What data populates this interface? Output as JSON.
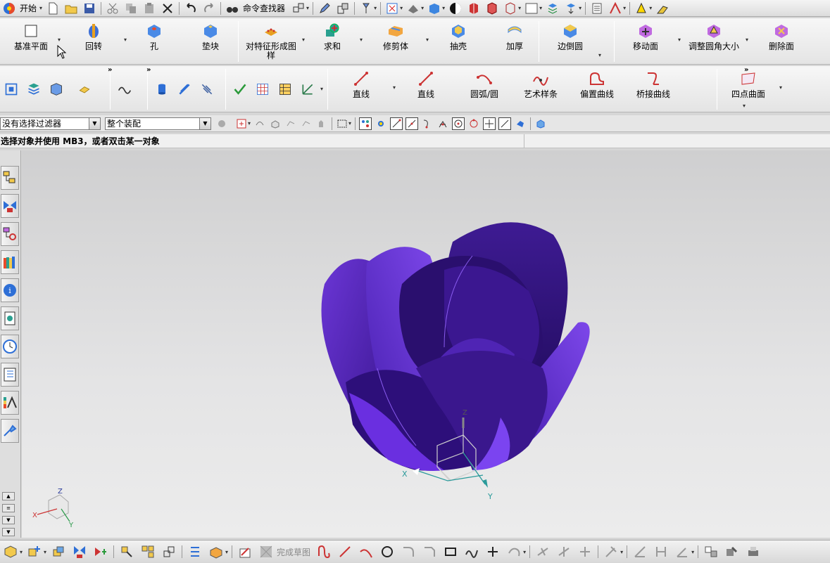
{
  "topbar": {
    "start_label": "开始",
    "command_finder_label": "命令查找器"
  },
  "ribbon1": {
    "items": [
      {
        "label": "基准平面",
        "icon": "datum-plane-icon"
      },
      {
        "label": "回转",
        "icon": "revolve-icon"
      },
      {
        "label": "孔",
        "icon": "hole-icon"
      },
      {
        "label": "垫块",
        "icon": "pad-icon"
      },
      {
        "label": "对特征形成图\n样",
        "icon": "pattern-feature-icon"
      },
      {
        "label": "求和",
        "icon": "unite-icon"
      },
      {
        "label": "修剪体",
        "icon": "trim-body-icon"
      },
      {
        "label": "抽壳",
        "icon": "shell-icon"
      },
      {
        "label": "加厚",
        "icon": "thicken-icon"
      },
      {
        "label": "边倒圆",
        "icon": "edge-blend-icon"
      },
      {
        "label": "移动面",
        "icon": "move-face-icon"
      },
      {
        "label": "调整圆角大小",
        "icon": "resize-blend-icon"
      },
      {
        "label": "删除面",
        "icon": "delete-face-icon"
      }
    ]
  },
  "ribbon2": {
    "curve_items": [
      {
        "label": "直线",
        "icon": "line-icon"
      },
      {
        "label": "直线",
        "icon": "line-icon"
      },
      {
        "label": "圆弧/圆",
        "icon": "arc-circle-icon"
      },
      {
        "label": "艺术样条",
        "icon": "studio-spline-icon"
      },
      {
        "label": "偏置曲线",
        "icon": "offset-curve-icon"
      },
      {
        "label": "桥接曲线",
        "icon": "bridge-curve-icon"
      }
    ],
    "surface_item": {
      "label": "四点曲面",
      "icon": "four-point-surface-icon"
    }
  },
  "filterbar": {
    "selection_filter": "没有选择过滤器",
    "scope": "整个装配"
  },
  "status": {
    "message": "选择对象并使用 MB3，或者双击某一对象"
  },
  "bottombar": {
    "finish_sketch_label": "完成草图"
  },
  "viewport": {
    "model_color": "#4a1fa6",
    "triad_labels": {
      "x": "X",
      "y": "Y",
      "z": "Z"
    }
  }
}
